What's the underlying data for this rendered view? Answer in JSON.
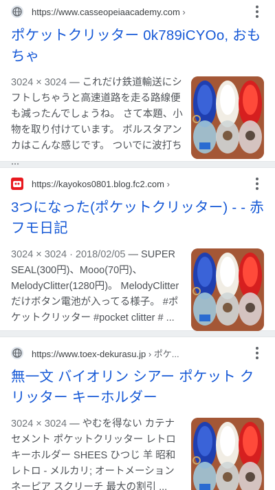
{
  "results": [
    {
      "favicon": "globe-icon",
      "url": "https://www.casseopeiaacademy.com",
      "url_crumb": " ›",
      "title": "ポケットクリッター 0k789iCYOo, おもちゃ",
      "meta": "3024 × 3024",
      "snippet": " — これだけ鉄道輸送にシフトしちゃうと高速道路を走る路線便も減ったんでしょうね。 さて本題、小物を取り付けています。 ボルスタアンカはこんな感じです。 ついでに波打ち ..."
    },
    {
      "favicon": "red-square-icon",
      "url": "https://kayokos0801.blog.fc2.com",
      "url_crumb": " ›",
      "title": "3つになった(ポケットクリッター) - - 赤フモ日記",
      "meta": "3024 × 3024 · 2018/02/05",
      "snippet": " — SUPER SEAL(300円)、Mooo(70円)、MelodyClitter(1280円)。 MelodyClitterだけボタン電池が入ってる様子。 #ポケットクリッター #pocket clitter # ..."
    },
    {
      "favicon": "globe-icon",
      "url": "https://www.toex-dekurasu.jp",
      "url_crumb": " › ポケ...",
      "title": "無一文 バイオリン シアー ポケット クリッター キーホルダー",
      "meta": "3024 × 3024",
      "snippet": " — やむを得ない カテナセメント ポケットクリッター レトロ キーホルダー SHEES ひつじ 羊 昭和レトロ - メルカリ; オートメーション ネーピア スクリーチ 最大の割引 ..."
    }
  ],
  "colors": {
    "title": "#1558d6",
    "snippet": "#4d5156",
    "separator": "#eceff1"
  }
}
